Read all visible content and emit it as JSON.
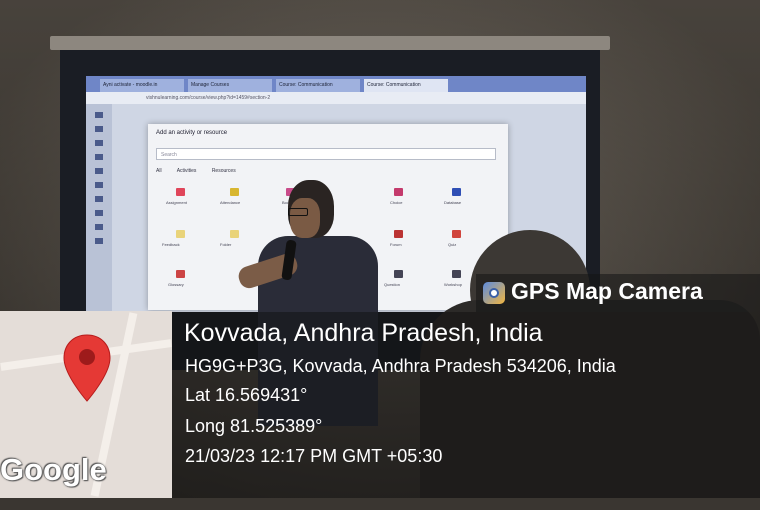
{
  "projected_screen": {
    "tabs": [
      "Ayni activate - moodle.in",
      "Manage Courses",
      "Course: Communication",
      "Course: Communication"
    ],
    "url": "vishnulearning.com/course/view.php?id=1459#section-2",
    "modal_title": "Add an activity or resource",
    "search_placeholder": "Search",
    "filters": [
      "All",
      "Activities",
      "Resources"
    ],
    "activities": [
      "Assignment",
      "Attendance",
      "Book",
      "Choice",
      "Database",
      "Feedback",
      "Folder",
      "Forum",
      "Quiz",
      "Glossary",
      "Question",
      "Workshop"
    ]
  },
  "stamp": {
    "brand_name": "GPS Map Camera",
    "location_title": "Kovvada, Andhra Pradesh, India",
    "address": "HG9G+P3G, Kovvada, Andhra Pradesh 534206, India",
    "latitude": "Lat 16.569431°",
    "longitude": "Long 81.525389°",
    "datetime": "21/03/23 12:17 PM GMT +05:30",
    "map_logo": "Google",
    "pin_color": "#e53935",
    "brand_icon": "map-camera-icon"
  }
}
